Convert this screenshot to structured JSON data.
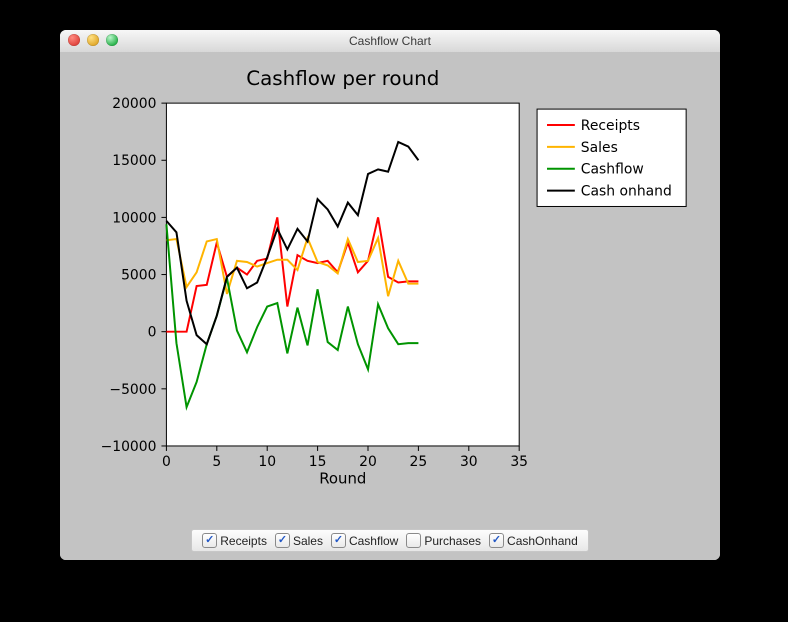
{
  "window": {
    "title": "Cashflow Chart"
  },
  "checkboxes": [
    {
      "key": "receipts",
      "label": "Receipts",
      "checked": true
    },
    {
      "key": "sales",
      "label": "Sales",
      "checked": true
    },
    {
      "key": "cashflow",
      "label": "Cashflow",
      "checked": true
    },
    {
      "key": "purchases",
      "label": "Purchases",
      "checked": false
    },
    {
      "key": "cashonhand",
      "label": "CashOnhand",
      "checked": true
    }
  ],
  "chart_data": {
    "type": "line",
    "title": "Cashflow per round",
    "xlabel": "Round",
    "ylabel": "",
    "xlim": [
      0,
      35
    ],
    "ylim": [
      -10000,
      20000
    ],
    "xticks": [
      0,
      5,
      10,
      15,
      20,
      25,
      30,
      35
    ],
    "yticks": [
      -10000,
      -5000,
      0,
      5000,
      10000,
      15000,
      20000
    ],
    "x": [
      0,
      1,
      2,
      3,
      4,
      5,
      6,
      7,
      8,
      9,
      10,
      11,
      12,
      13,
      14,
      15,
      16,
      17,
      18,
      19,
      20,
      21,
      22,
      23,
      24,
      25
    ],
    "legend": [
      "Receipts",
      "Sales",
      "Cashflow",
      "Cash onhand"
    ],
    "colors": {
      "Receipts": "#ff0000",
      "Sales": "#ffb400",
      "Cashflow": "#009400",
      "Cash onhand": "#000000"
    },
    "series": [
      {
        "name": "Receipts",
        "values": [
          0,
          0,
          0,
          4000,
          4100,
          7800,
          4800,
          5600,
          5000,
          6200,
          6400,
          10000,
          2200,
          6700,
          6200,
          6000,
          6200,
          5200,
          7800,
          5200,
          6200,
          10000,
          4800,
          4300,
          4400,
          4400
        ]
      },
      {
        "name": "Sales",
        "values": [
          8000,
          8100,
          3900,
          5200,
          7900,
          8100,
          3300,
          6200,
          6100,
          5700,
          6000,
          6300,
          6300,
          5400,
          8200,
          6100,
          5800,
          5100,
          8100,
          6100,
          6200,
          8200,
          3100,
          6200,
          4200,
          4200
        ]
      },
      {
        "name": "Cashflow",
        "values": [
          9400,
          -1000,
          -6600,
          -4400,
          -1100,
          1400,
          4700,
          100,
          -1800,
          400,
          2200,
          2500,
          -1900,
          2100,
          -1200,
          3700,
          -900,
          -1600,
          2200,
          -1100,
          -3300,
          2400,
          300,
          -1100,
          -1000,
          -1000
        ]
      },
      {
        "name": "Cash onhand",
        "values": [
          9700,
          8700,
          2700,
          -300,
          -1100,
          1400,
          4800,
          5600,
          3800,
          4300,
          6500,
          9000,
          7200,
          9000,
          7900,
          11600,
          10700,
          9200,
          11300,
          10200,
          13800,
          14200,
          14000,
          16600,
          16200,
          15000
        ]
      }
    ]
  }
}
